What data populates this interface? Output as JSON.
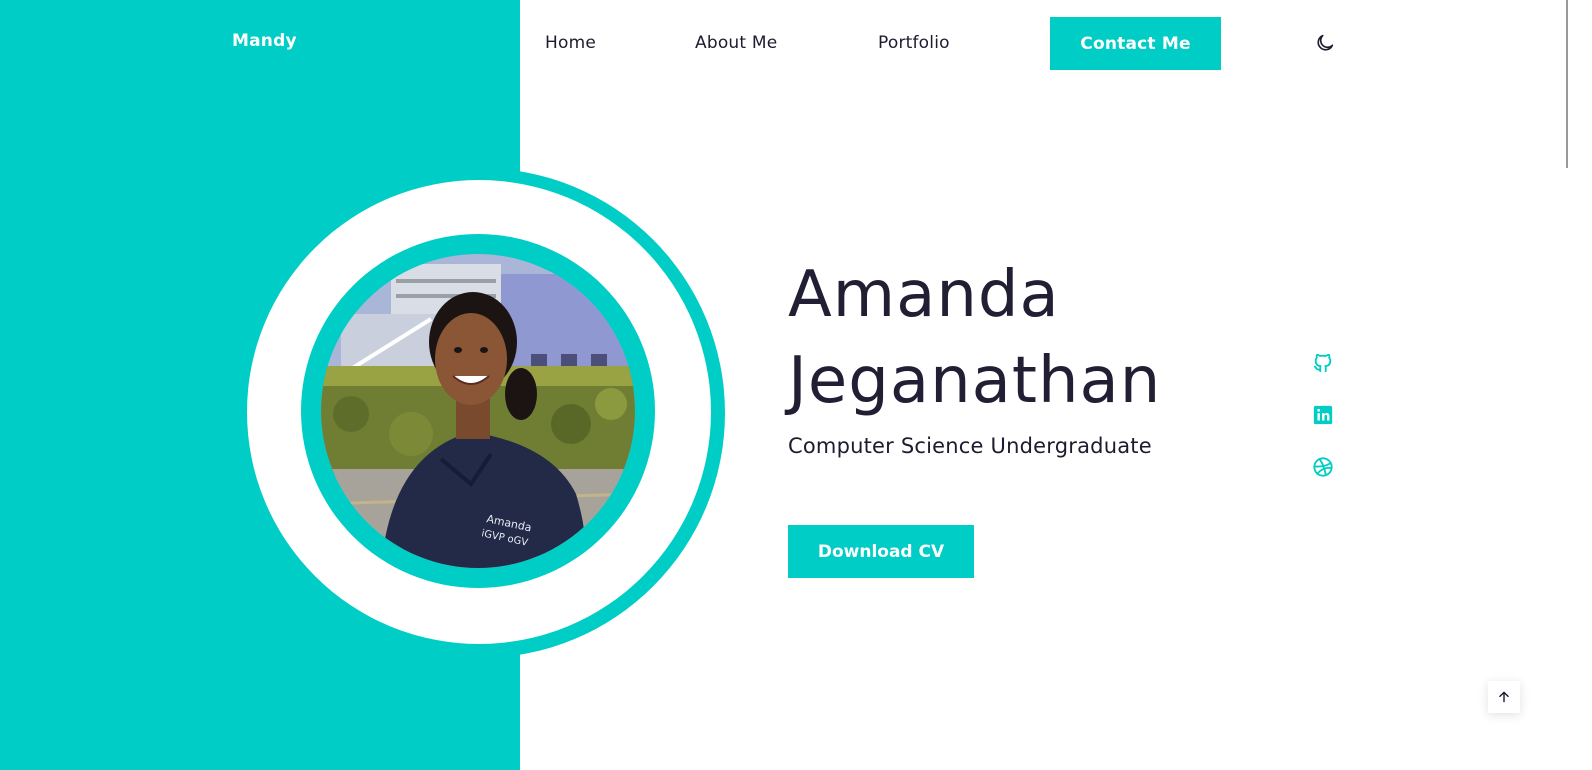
{
  "brand": {
    "name": "Mandy"
  },
  "nav": {
    "home": "Home",
    "about": "About Me",
    "portfolio": "Portfolio",
    "contact": "Contact Me"
  },
  "hero": {
    "first_name": "Amanda",
    "last_name": "Jeganathan",
    "role": "Computer Science Undergraduate",
    "cv_button": "Download CV"
  },
  "icons": {
    "theme_toggle": "moon-icon",
    "social": [
      "github-icon",
      "linkedin-icon",
      "dribbble-icon"
    ],
    "scroll_top": "arrow-up-icon"
  },
  "colors": {
    "accent": "#00cdc6",
    "text_dark": "#221f35",
    "background": "#ffffff"
  }
}
